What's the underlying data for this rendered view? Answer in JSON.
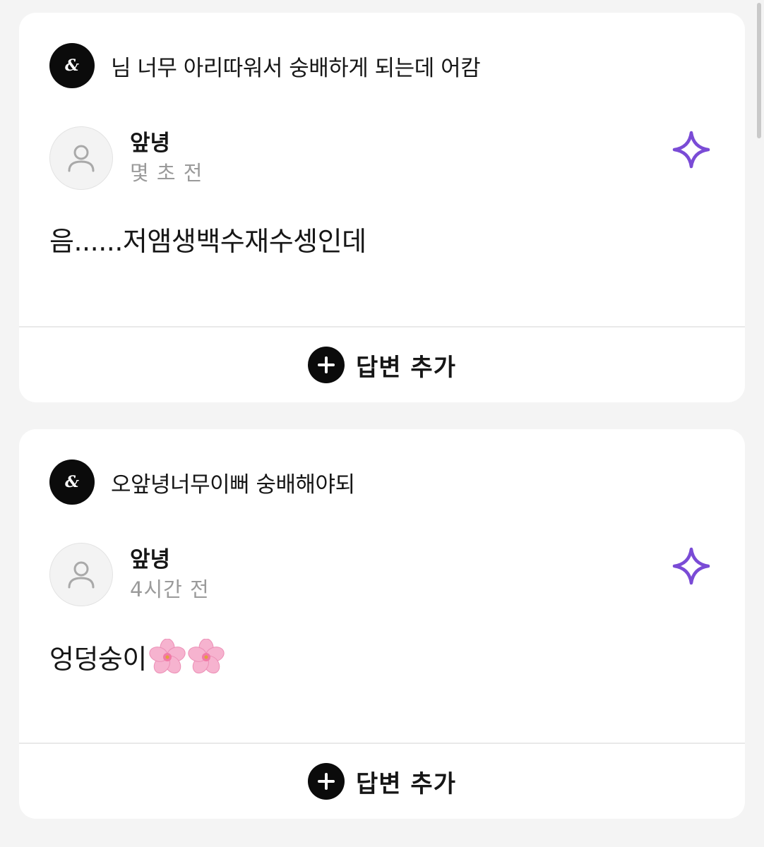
{
  "colors": {
    "background": "#f4f4f4",
    "card": "#ffffff",
    "accent_sparkle": "#7a4bd6",
    "muted_text": "#9a9a9a",
    "primary_text": "#161616"
  },
  "cards": [
    {
      "question": "님 너무 아리따워서 숭배하게 되는데 어캄",
      "asker_icon": "brand-badge-icon",
      "author_name": "앞녕",
      "timestamp": "몇 초 전",
      "answer": "음......저앰생백수재수셍인데",
      "answer_emojis": [],
      "reply_label": "답변 추가",
      "sparkle_icon": "sparkle-icon"
    },
    {
      "question": "오앞녕너무이뻐 숭배해야되",
      "asker_icon": "brand-badge-icon",
      "author_name": "앞녕",
      "timestamp": "4시간 전",
      "answer": "엉덩숭이",
      "answer_emojis": [
        "cherry-blossom",
        "cherry-blossom"
      ],
      "reply_label": "답변 추가",
      "sparkle_icon": "sparkle-icon"
    }
  ]
}
